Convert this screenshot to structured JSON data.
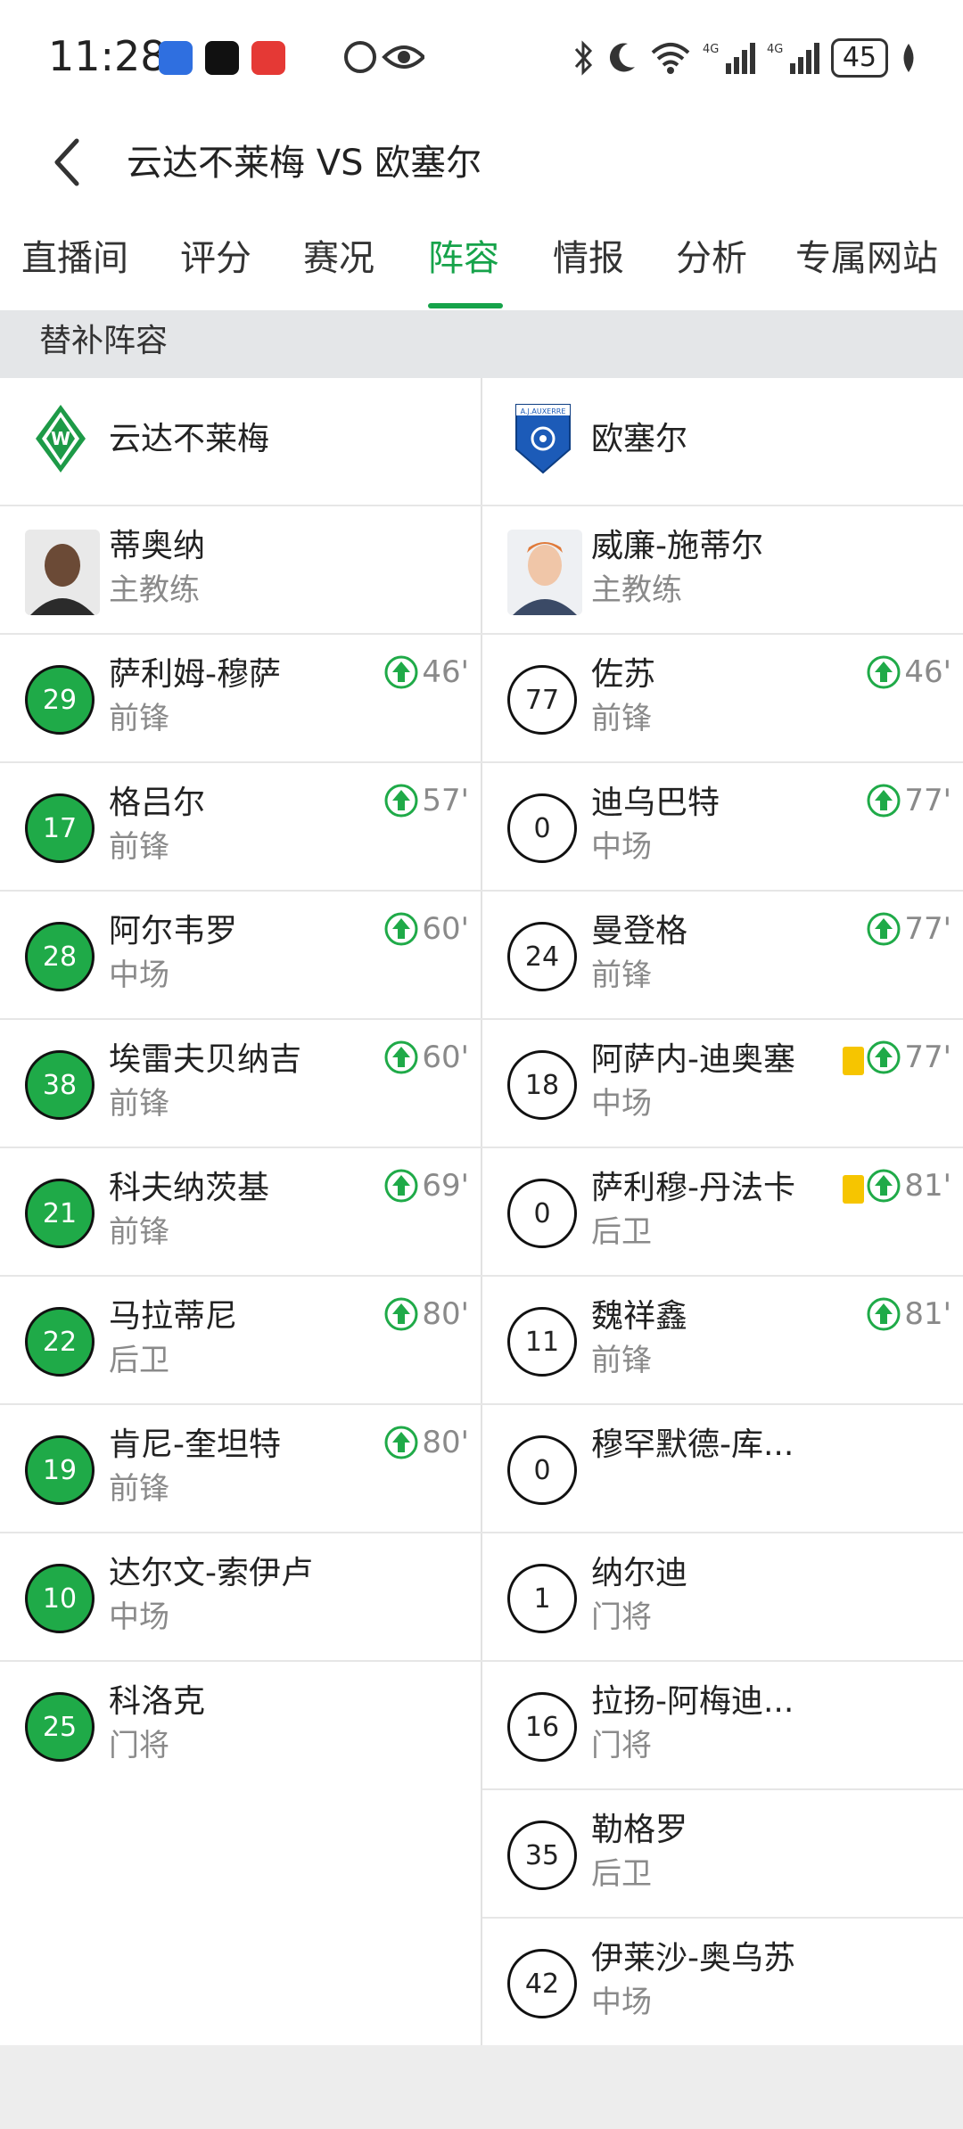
{
  "status_bar": {
    "time": "11:28",
    "battery": "45",
    "icons": [
      "app-icon-blue",
      "tiktok-icon",
      "huawei-icon",
      "eye-icon",
      "bluetooth-icon",
      "moon-icon",
      "wifi-icon",
      "signal-icon",
      "battery-icon"
    ]
  },
  "header": {
    "title": "云达不莱梅 VS 欧塞尔"
  },
  "tabs": [
    "直播间",
    "评分",
    "赛况",
    "阵容",
    "情报",
    "分析",
    "专属网站"
  ],
  "active_tab": "阵容",
  "section_title": "替补阵容",
  "home": {
    "team": "云达不莱梅",
    "coach": {
      "name": "蒂奥纳",
      "role": "主教练"
    },
    "players": [
      {
        "number": "29",
        "name": "萨利姆-穆萨",
        "role": "前锋",
        "sub": "46'"
      },
      {
        "number": "17",
        "name": "格吕尔",
        "role": "前锋",
        "sub": "57'"
      },
      {
        "number": "28",
        "name": "阿尔韦罗",
        "role": "中场",
        "sub": "60'"
      },
      {
        "number": "38",
        "name": "埃雷夫贝纳吉",
        "role": "前锋",
        "sub": "60'"
      },
      {
        "number": "21",
        "name": "科夫纳茨基",
        "role": "前锋",
        "sub": "69'"
      },
      {
        "number": "22",
        "name": "马拉蒂尼",
        "role": "后卫",
        "sub": "80'"
      },
      {
        "number": "19",
        "name": "肯尼-奎坦特",
        "role": "前锋",
        "sub": "80'"
      },
      {
        "number": "10",
        "name": "达尔文-索伊卢",
        "role": "中场",
        "sub": ""
      },
      {
        "number": "25",
        "name": "科洛克",
        "role": "门将",
        "sub": ""
      }
    ]
  },
  "away": {
    "team": "欧塞尔",
    "coach": {
      "name": "威廉-施蒂尔",
      "role": "主教练"
    },
    "players": [
      {
        "number": "77",
        "name": "佐苏",
        "role": "前锋",
        "sub": "46'"
      },
      {
        "number": "0",
        "name": "迪乌巴特",
        "role": "中场",
        "sub": "77'"
      },
      {
        "number": "24",
        "name": "曼登格",
        "role": "前锋",
        "sub": "77'"
      },
      {
        "number": "18",
        "name": "阿萨内-迪奥塞",
        "role": "中场",
        "sub": "77'"
      },
      {
        "number": "0",
        "name": "萨利穆-丹法卡",
        "role": "后卫",
        "sub": "81'"
      },
      {
        "number": "11",
        "name": "魏祥鑫",
        "role": "前锋",
        "sub": "81'"
      },
      {
        "number": "0",
        "name": "穆罕默德-库...",
        "role": "",
        "sub": ""
      },
      {
        "number": "1",
        "name": "纳尔迪",
        "role": "门将",
        "sub": ""
      },
      {
        "number": "16",
        "name": "拉扬-阿梅迪...",
        "role": "门将",
        "sub": ""
      },
      {
        "number": "35",
        "name": "勒格罗",
        "role": "后卫",
        "sub": ""
      },
      {
        "number": "42",
        "name": "伊莱沙-奥乌苏",
        "role": "中场",
        "sub": ""
      }
    ]
  },
  "colors": {
    "accent": "#16a34a",
    "home_number_bg": "#1faa48",
    "yellow_card": "#f6c500"
  }
}
